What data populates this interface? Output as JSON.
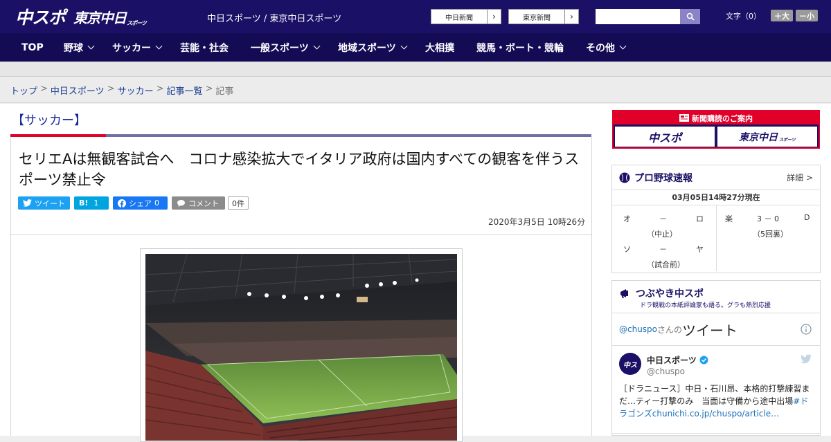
{
  "header": {
    "logo_chuspo": "中スポ",
    "logo_tokyo": "東京中日",
    "logo_tokyo_sub": "スポーツ",
    "site_title": "中日スポーツ / 東京中日スポーツ",
    "newspaper_buttons": [
      "中日新聞",
      "東京新聞"
    ],
    "search_placeholder": "",
    "font_label": "文字（0）",
    "font_larger": "＋大",
    "font_smaller": "－小"
  },
  "nav": {
    "items": [
      {
        "label": "TOP",
        "dropdown": false
      },
      {
        "label": "野球",
        "dropdown": true
      },
      {
        "label": "サッカー",
        "dropdown": true
      },
      {
        "label": "芸能・社会",
        "dropdown": false
      },
      {
        "label": "一般スポーツ",
        "dropdown": true
      },
      {
        "label": "地域スポーツ",
        "dropdown": true
      },
      {
        "label": "大相撲",
        "dropdown": false
      },
      {
        "label": "競馬・ボート・競輪",
        "dropdown": false
      },
      {
        "label": "その他",
        "dropdown": true
      }
    ]
  },
  "breadcrumb": {
    "items": [
      "トップ",
      "中日スポーツ",
      "サッカー",
      "記事一覧",
      "記事"
    ],
    "separator": ">"
  },
  "article": {
    "category": "【サッカー】",
    "headline": "セリエAは無観客試合へ　コロナ感染拡大でイタリア政府は国内すべての観客を伴うスポーツ禁止令",
    "share": {
      "tweet": "ツイート",
      "hatena": "B!",
      "hatena_count": "1",
      "facebook": "シェア",
      "facebook_count": "0",
      "comment": "コメント",
      "comment_count": "0件"
    },
    "date": "2020年3月5日 10時26分"
  },
  "sidebar": {
    "ad_title": "新聞購読のご案内",
    "ad_buttons": [
      "中スポ",
      "東京中日"
    ],
    "ad_sub": "スポーツ",
    "baseball": {
      "title": "プロ野球速報",
      "more": "詳細 >",
      "timestamp": "03月05日14時27分現在",
      "games": [
        {
          "home": "オ",
          "score": "－",
          "away": "ロ",
          "status": "（中止）"
        },
        {
          "home": "ソ",
          "score": "－",
          "away": "ヤ",
          "status": "（試合前）"
        },
        {
          "home": "楽",
          "score": "3 － 0",
          "away": "D",
          "status": "（5回裏）"
        }
      ]
    },
    "tsubuyaki": {
      "title": "つぶやき中スポ",
      "subtitle": "ドラ観戦の本紙評論家も語る。グラも熱烈応援",
      "tweets_by_handle": "@chuspo",
      "tweets_by_suffix": "さんの",
      "tweets_label": "ツイート",
      "account_name": "中日スポーツ",
      "account_handle": "@chuspo",
      "tweet_text": "［ドラニュース］中日・石川昂、本格的打撃練習ま だ…ティー打撃のみ　当面は守備から途中出場",
      "tweet_link": "#ドラゴンズchunichi.co.jp/chuspo/article…"
    }
  },
  "colors": {
    "header_bg": "#1a1166",
    "nav_bg": "#130c55",
    "accent_red": "#e0002a",
    "link": "#1a3d8f"
  }
}
